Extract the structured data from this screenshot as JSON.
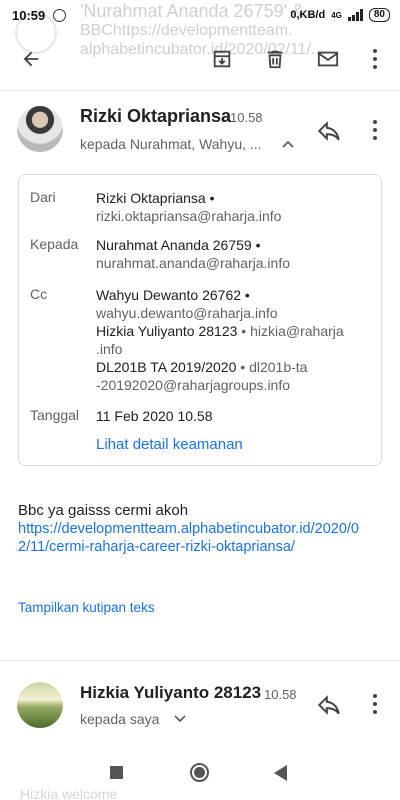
{
  "status_bar": {
    "time": "10:59",
    "network_speed": "0,KB/d",
    "network_type": "4G",
    "battery": "80"
  },
  "ghost_subject": {
    "line1": "'Nurahmat Ananda 26759' &...",
    "line2": "BBChttps://developmentteam.",
    "line3": "alphabetincubator.id/2020/02/11/..."
  },
  "toolbar": {
    "back_icon": "arrow-back-icon",
    "archive_icon": "archive-icon",
    "delete_icon": "delete-icon",
    "mark_unread_icon": "mail-icon",
    "more_icon": "more-vert-icon"
  },
  "message1": {
    "sender": "Rizki Oktapriansa",
    "time": "10.58",
    "recipients": "kepada Nurahmat, Wahyu, ..."
  },
  "details": {
    "from_label": "Dari",
    "from_name": "Rizki Oktapriansa •",
    "from_email": "rizki.oktapriansa@raharja.info",
    "to_label": "Kepada",
    "to_name": "Nurahmat Ananda 26759 •",
    "to_email": "nurahmat.ananda@raharja.info",
    "cc_label": "Cc",
    "cc1_name": "Wahyu Dewanto 26762 •",
    "cc1_email": "wahyu.dewanto@raharja.info",
    "cc2_name": "Hizkia Yuliyanto 28123",
    "cc2_rest": " • hizkia@raharja",
    "cc2_email2": ".info",
    "cc3_name": "DL201B TA 2019/2020",
    "cc3_rest": " • dl201b-ta",
    "cc3_email2": "-20192020@raharjagroups.info",
    "date_label": "Tanggal",
    "date_value": "11 Feb 2020 10.58",
    "security_link": "Lihat detail keamanan"
  },
  "body": {
    "text": "Bbc ya gaisss cermi akoh",
    "link": "https://developmentteam.alphabetincubator.id/2020/02/11/cermi-raharja-career-rizki-oktapriansa/",
    "show_quoted": "Tampilkan kutipan teks"
  },
  "message2": {
    "sender": "Hizkia Yuliyanto 28123",
    "time": "10.58",
    "recipients": "kepada saya",
    "preview": "Hizkia welcome"
  },
  "colors": {
    "accent": "#1a73e8",
    "text": "#202124",
    "secondary": "#5f6368",
    "border": "#dadce0"
  }
}
